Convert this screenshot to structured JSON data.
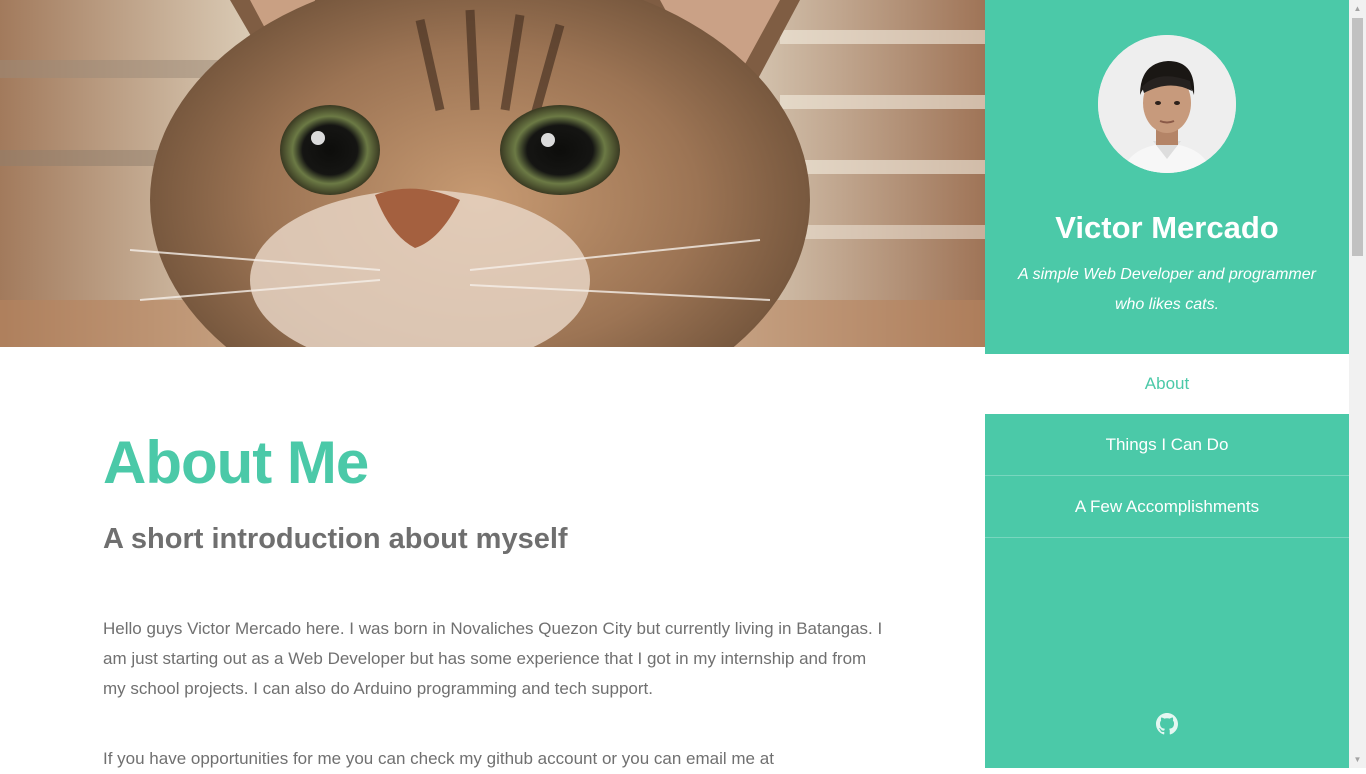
{
  "hero": {
    "icon": "cat-photo"
  },
  "main": {
    "title": "About Me",
    "subtitle": "A short introduction about myself",
    "intro": "Hello guys Victor Mercado here. I was born in Novaliches Quezon City but currently living in Batangas. I am just starting out as a Web Developer but has some experience that I got in my internship and from my school projects. I can also do Arduino programming and tech support.",
    "contact": "If you have opportunities for me you can check my github account or you can email me at"
  },
  "sidebar": {
    "name": "Victor Mercado",
    "tagline": "A simple Web Developer and programmer who likes cats.",
    "nav": [
      {
        "label": "About",
        "active": true
      },
      {
        "label": "Things I Can Do",
        "active": false
      },
      {
        "label": "A Few Accomplishments",
        "active": false
      }
    ],
    "social_icon": "github-icon"
  },
  "colors": {
    "accent": "#4bc9a8",
    "text": "#707070",
    "heading": "#6f6f6f",
    "white": "#ffffff"
  }
}
